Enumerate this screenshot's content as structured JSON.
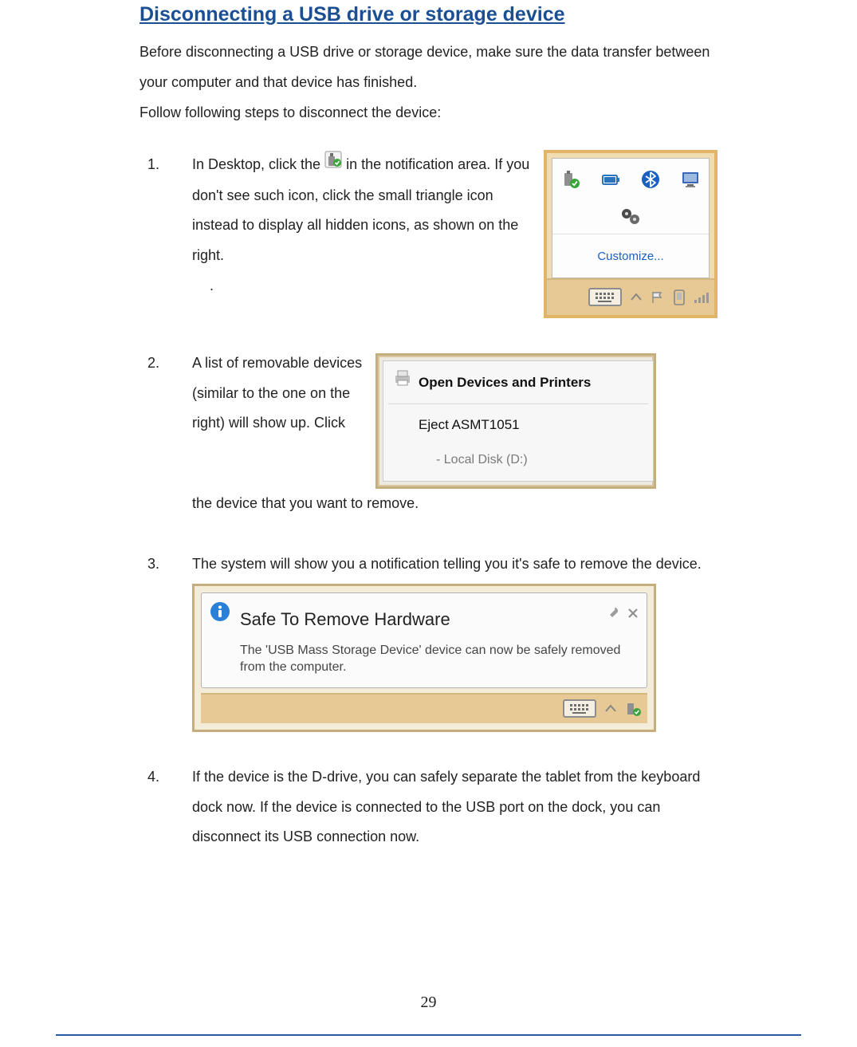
{
  "heading": "Disconnecting a USB drive or storage device",
  "intro_p1": "Before disconnecting a USB drive or storage device, make sure the data transfer between your computer and that device has finished.",
  "intro_p2": "Follow following steps to disconnect the device:",
  "steps": {
    "s1": {
      "num": "1.",
      "text_a": "In Desktop, click the ",
      "text_b": " in the notification area. If you don't see such icon, click the small triangle icon instead to display all hidden icons, as shown on the right.",
      "dot": "."
    },
    "s2": {
      "num": "2.",
      "text": "A list of removable devices (similar to the one on the right) will show up. Click the device that you want to remove."
    },
    "s3": {
      "num": "3.",
      "text": "The system will show you a notification telling you it's safe to remove the device."
    },
    "s4": {
      "num": "4.",
      "text": "If the device is the D-drive, you can safely separate the tablet from the keyboard dock now. If the device is connected to the USB port on the dock, you can disconnect its USB connection now."
    }
  },
  "tray": {
    "customize": "Customize..."
  },
  "eject_menu": {
    "open": "Open Devices and Printers",
    "eject": "Eject ASMT1051",
    "local": "-   Local Disk (D:)"
  },
  "balloon": {
    "title": "Safe To Remove Hardware",
    "msg": "The 'USB Mass Storage Device' device can now be safely removed from the computer."
  },
  "page_number": "29"
}
